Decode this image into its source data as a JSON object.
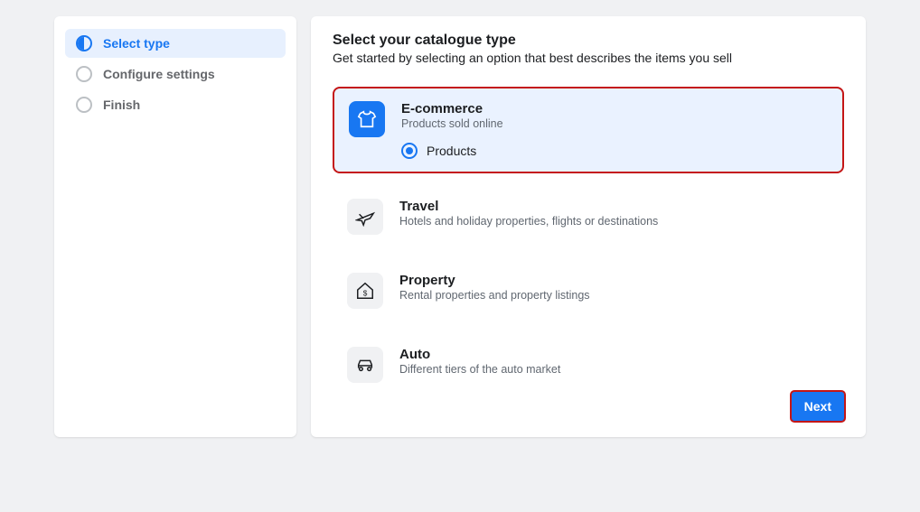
{
  "sidebar": {
    "steps": [
      {
        "label": "Select type"
      },
      {
        "label": "Configure settings"
      },
      {
        "label": "Finish"
      }
    ]
  },
  "main": {
    "heading": "Select your catalogue type",
    "subtitle": "Get started by selecting an option that best describes the items you sell",
    "options": [
      {
        "title": "E-commerce",
        "desc": "Products sold online",
        "radio_label": "Products"
      },
      {
        "title": "Travel",
        "desc": "Hotels and holiday properties, flights or destinations"
      },
      {
        "title": "Property",
        "desc": "Rental properties and property listings"
      },
      {
        "title": "Auto",
        "desc": "Different tiers of the auto market"
      }
    ],
    "next_label": "Next"
  }
}
